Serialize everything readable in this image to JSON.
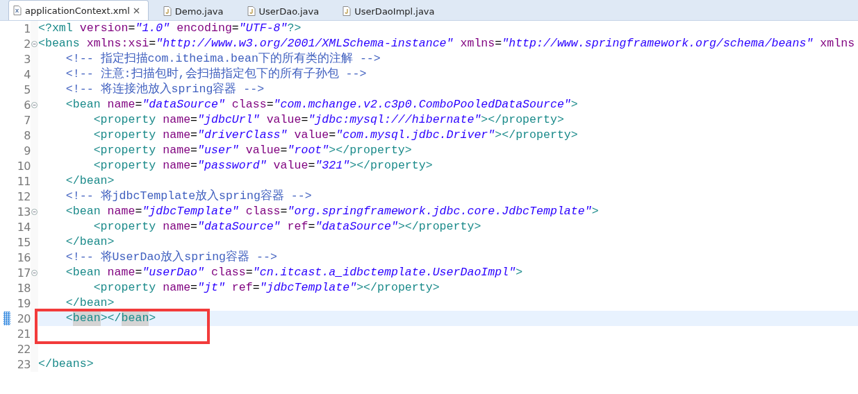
{
  "tabs": [
    {
      "label": "applicationContext.xml",
      "kind": "xml",
      "selected": true,
      "closable": true
    },
    {
      "label": "Demo.java",
      "kind": "java",
      "selected": false,
      "closable": false
    },
    {
      "label": "UserDao.java",
      "kind": "java",
      "selected": false,
      "closable": false
    },
    {
      "label": "UserDaoImpl.java",
      "kind": "java",
      "selected": false,
      "closable": false
    }
  ],
  "editor": {
    "lines": [
      {
        "number": "1",
        "fold": false,
        "current": false,
        "tokens": [
          {
            "kind": "tag",
            "text": "<?xml"
          },
          {
            "kind": "attr",
            "text": " version"
          },
          {
            "kind": "plain",
            "text": "="
          },
          {
            "kind": "value",
            "text": "\"1.0\""
          },
          {
            "kind": "attr",
            "text": " encoding"
          },
          {
            "kind": "plain",
            "text": "="
          },
          {
            "kind": "value",
            "text": "\"UTF-8\""
          },
          {
            "kind": "tag",
            "text": "?>"
          }
        ]
      },
      {
        "number": "2",
        "fold": true,
        "current": false,
        "tokens": [
          {
            "kind": "tag",
            "text": "<beans"
          },
          {
            "kind": "attr",
            "text": " xmlns:xsi"
          },
          {
            "kind": "plain",
            "text": "="
          },
          {
            "kind": "value",
            "text": "\"http://www.w3.org/2001/XMLSchema-instance\""
          },
          {
            "kind": "attr",
            "text": " xmlns"
          },
          {
            "kind": "plain",
            "text": "="
          },
          {
            "kind": "value",
            "text": "\"http://www.springframework.org/schema/beans\""
          },
          {
            "kind": "attr",
            "text": " xmlns"
          }
        ]
      },
      {
        "number": "3",
        "fold": false,
        "current": false,
        "tokens": [
          {
            "kind": "comment",
            "text": "    <!-- 指定扫描com.itheima.bean下的所有类的注解 -->"
          }
        ]
      },
      {
        "number": "4",
        "fold": false,
        "current": false,
        "tokens": [
          {
            "kind": "comment",
            "text": "    <!-- 注意:扫描包时,会扫描指定包下的所有子孙包 -->"
          }
        ]
      },
      {
        "number": "5",
        "fold": false,
        "current": false,
        "tokens": [
          {
            "kind": "comment",
            "text": "    <!-- 将连接池放入spring容器 -->"
          }
        ]
      },
      {
        "number": "6",
        "fold": true,
        "current": false,
        "tokens": [
          {
            "kind": "tag",
            "text": "    <bean"
          },
          {
            "kind": "attr",
            "text": " name"
          },
          {
            "kind": "plain",
            "text": "="
          },
          {
            "kind": "value",
            "text": "\"dataSource\""
          },
          {
            "kind": "attr",
            "text": " class"
          },
          {
            "kind": "plain",
            "text": "="
          },
          {
            "kind": "value",
            "text": "\"com.mchange.v2.c3p0.ComboPooledDataSource\""
          },
          {
            "kind": "tag",
            "text": ">"
          }
        ]
      },
      {
        "number": "7",
        "fold": false,
        "current": false,
        "tokens": [
          {
            "kind": "tag",
            "text": "        <property"
          },
          {
            "kind": "attr",
            "text": " name"
          },
          {
            "kind": "plain",
            "text": "="
          },
          {
            "kind": "value",
            "text": "\"jdbcUrl\""
          },
          {
            "kind": "attr",
            "text": " value"
          },
          {
            "kind": "plain",
            "text": "="
          },
          {
            "kind": "value",
            "text": "\"jdbc:mysql:///hibernate\""
          },
          {
            "kind": "tag",
            "text": "></property>"
          }
        ]
      },
      {
        "number": "8",
        "fold": false,
        "current": false,
        "tokens": [
          {
            "kind": "tag",
            "text": "        <property"
          },
          {
            "kind": "attr",
            "text": " name"
          },
          {
            "kind": "plain",
            "text": "="
          },
          {
            "kind": "value",
            "text": "\"driverClass\""
          },
          {
            "kind": "attr",
            "text": " value"
          },
          {
            "kind": "plain",
            "text": "="
          },
          {
            "kind": "value",
            "text": "\"com.mysql.jdbc.Driver\""
          },
          {
            "kind": "tag",
            "text": "></property>"
          }
        ]
      },
      {
        "number": "9",
        "fold": false,
        "current": false,
        "tokens": [
          {
            "kind": "tag",
            "text": "        <property"
          },
          {
            "kind": "attr",
            "text": " name"
          },
          {
            "kind": "plain",
            "text": "="
          },
          {
            "kind": "value",
            "text": "\"user\""
          },
          {
            "kind": "attr",
            "text": " value"
          },
          {
            "kind": "plain",
            "text": "="
          },
          {
            "kind": "value",
            "text": "\"root\""
          },
          {
            "kind": "tag",
            "text": "></property>"
          }
        ]
      },
      {
        "number": "10",
        "fold": false,
        "current": false,
        "tokens": [
          {
            "kind": "tag",
            "text": "        <property"
          },
          {
            "kind": "attr",
            "text": " name"
          },
          {
            "kind": "plain",
            "text": "="
          },
          {
            "kind": "value",
            "text": "\"password\""
          },
          {
            "kind": "attr",
            "text": " value"
          },
          {
            "kind": "plain",
            "text": "="
          },
          {
            "kind": "value",
            "text": "\"321\""
          },
          {
            "kind": "tag",
            "text": "></property>"
          }
        ]
      },
      {
        "number": "11",
        "fold": false,
        "current": false,
        "tokens": [
          {
            "kind": "tag",
            "text": "    </bean>"
          }
        ]
      },
      {
        "number": "12",
        "fold": false,
        "current": false,
        "tokens": [
          {
            "kind": "comment",
            "text": "    <!-- 将jdbcTemplate放入spring容器 -->"
          }
        ]
      },
      {
        "number": "13",
        "fold": true,
        "current": false,
        "tokens": [
          {
            "kind": "tag",
            "text": "    <bean"
          },
          {
            "kind": "attr",
            "text": " name"
          },
          {
            "kind": "plain",
            "text": "="
          },
          {
            "kind": "value",
            "text": "\"jdbcTemplate\""
          },
          {
            "kind": "attr",
            "text": " class"
          },
          {
            "kind": "plain",
            "text": "="
          },
          {
            "kind": "value",
            "text": "\"org.springframework.jdbc.core.JdbcTemplate\""
          },
          {
            "kind": "tag",
            "text": ">"
          }
        ]
      },
      {
        "number": "14",
        "fold": false,
        "current": false,
        "tokens": [
          {
            "kind": "tag",
            "text": "        <property"
          },
          {
            "kind": "attr",
            "text": " name"
          },
          {
            "kind": "plain",
            "text": "="
          },
          {
            "kind": "value",
            "text": "\"dataSource\""
          },
          {
            "kind": "attr",
            "text": " ref"
          },
          {
            "kind": "plain",
            "text": "="
          },
          {
            "kind": "value",
            "text": "\"dataSource\""
          },
          {
            "kind": "tag",
            "text": "></property>"
          }
        ]
      },
      {
        "number": "15",
        "fold": false,
        "current": false,
        "tokens": [
          {
            "kind": "tag",
            "text": "    </bean>"
          }
        ]
      },
      {
        "number": "16",
        "fold": false,
        "current": false,
        "tokens": [
          {
            "kind": "comment",
            "text": "    <!-- 将UserDao放入spring容器 -->"
          }
        ]
      },
      {
        "number": "17",
        "fold": true,
        "current": false,
        "tokens": [
          {
            "kind": "tag",
            "text": "    <bean"
          },
          {
            "kind": "attr",
            "text": " name"
          },
          {
            "kind": "plain",
            "text": "="
          },
          {
            "kind": "value",
            "text": "\"userDao\""
          },
          {
            "kind": "attr",
            "text": " class"
          },
          {
            "kind": "plain",
            "text": "="
          },
          {
            "kind": "value",
            "text": "\"cn.itcast.a_idbctemplate.UserDaoImpl\""
          },
          {
            "kind": "tag",
            "text": ">"
          }
        ]
      },
      {
        "number": "18",
        "fold": false,
        "current": false,
        "tokens": [
          {
            "kind": "tag",
            "text": "        <property"
          },
          {
            "kind": "attr",
            "text": " name"
          },
          {
            "kind": "plain",
            "text": "="
          },
          {
            "kind": "value",
            "text": "\"jt\""
          },
          {
            "kind": "attr",
            "text": " ref"
          },
          {
            "kind": "plain",
            "text": "="
          },
          {
            "kind": "value",
            "text": "\"jdbcTemplate\""
          },
          {
            "kind": "tag",
            "text": "></property>"
          }
        ]
      },
      {
        "number": "19",
        "fold": false,
        "current": false,
        "tokens": [
          {
            "kind": "tag",
            "text": "    </bean>"
          }
        ]
      },
      {
        "number": "20",
        "fold": false,
        "current": true,
        "tokens": [
          {
            "kind": "tag",
            "text": "    <"
          },
          {
            "kind": "match",
            "text": "bean"
          },
          {
            "kind": "tag",
            "text": "></"
          },
          {
            "kind": "match",
            "text": "bean"
          },
          {
            "kind": "tag",
            "text": ">"
          }
        ]
      },
      {
        "number": "21",
        "fold": false
      },
      {
        "number": "22",
        "fold": false
      },
      {
        "number": "23",
        "fold": false,
        "current": false,
        "tokens": [
          {
            "kind": "tag",
            "text": "</beans>"
          }
        ]
      }
    ]
  }
}
